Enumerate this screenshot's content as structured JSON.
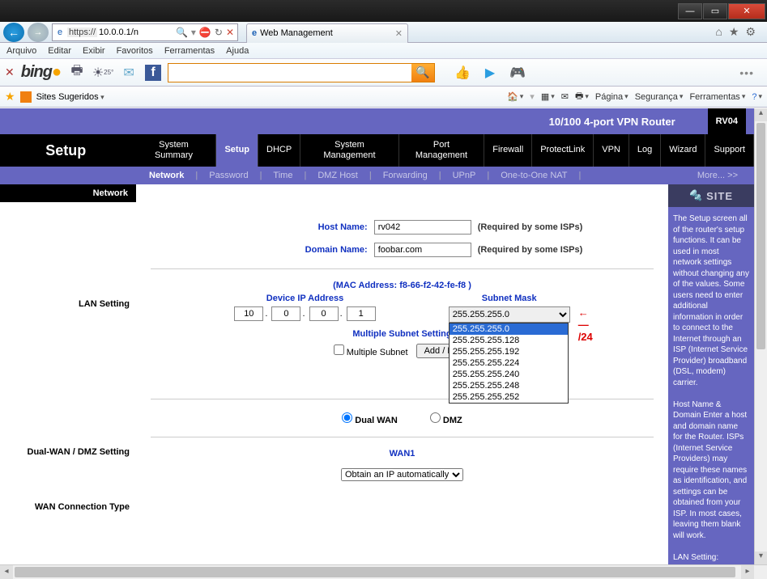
{
  "window": {
    "title": "Web Management"
  },
  "address": {
    "proto": "https://",
    "url": "10.0.0.1/n",
    "search_suffix": "ρ"
  },
  "tabs": [
    {
      "icon": "e",
      "label": "Web Management"
    }
  ],
  "menubar": [
    "Arquivo",
    "Editar",
    "Exibir",
    "Favoritos",
    "Ferramentas",
    "Ajuda"
  ],
  "bing": {
    "label": "bing",
    "temp": "25°"
  },
  "favbar": {
    "label": "Sites Sugeridos",
    "right": [
      "Página",
      "Segurança",
      "Ferramentas"
    ]
  },
  "brand": {
    "title": "10/100 4-port VPN Router",
    "model": "RV04"
  },
  "mainnav": {
    "setup_label": "Setup",
    "items": [
      "System Summary",
      "Setup",
      "DHCP",
      "System Management",
      "Port Management",
      "Firewall",
      "ProtectLink",
      "VPN",
      "Log",
      "Wizard",
      "Support"
    ],
    "active_index": 1
  },
  "subnav": {
    "items": [
      "Network",
      "Password",
      "Time",
      "DMZ Host",
      "Forwarding",
      "UPnP",
      "One-to-One NAT"
    ],
    "active_index": 0,
    "more": "More...   >>"
  },
  "leftnav": {
    "header": "Network",
    "sections": [
      "LAN Setting",
      "Dual-WAN / DMZ Setting",
      "WAN Connection Type"
    ]
  },
  "hostname": {
    "label": "Host Name:",
    "value": "rv042",
    "note": "(Required by some ISPs)"
  },
  "domain": {
    "label": "Domain Name:",
    "value": "foobar.com",
    "note": "(Required by some ISPs)"
  },
  "mac": {
    "label": "(MAC Address: f8-66-f2-42-fe-f8 )"
  },
  "deviceip": {
    "title": "Device IP Address",
    "octets": [
      "10",
      "0",
      "0",
      "1"
    ]
  },
  "subnet": {
    "title": "Subnet Mask",
    "selected": "255.255.255.0",
    "options": [
      "255.255.255.0",
      "255.255.255.128",
      "255.255.255.192",
      "255.255.255.224",
      "255.255.255.240",
      "255.255.255.248",
      "255.255.255.252"
    ],
    "annotation": "/24"
  },
  "multisubnet": {
    "title": "Multiple Subnet Setting",
    "checkbox_label": "Multiple Subnet",
    "button": "Add / Edit"
  },
  "wan_radio": {
    "opt1": "Dual WAN",
    "opt2": "DMZ"
  },
  "wan1": {
    "title": "WAN1",
    "select": "Obtain an IP automatically"
  },
  "sidebar": {
    "head": "SITE",
    "text1": "The Setup screen all of the router's setup functions. It can be used in most network settings without changing any of the values. Some users need to enter additional information in order to connect to the Internet through an ISP (Internet Service Provider) broadband (DSL, modem) carrier.",
    "text2": "Host Name & Domain Enter a host and domain name for the Router. ISPs (Internet Service Providers) may require these names as identification, and settings can be obtained from your ISP. In most cases, leaving them blank will work.",
    "text3": "LAN Setting:"
  }
}
